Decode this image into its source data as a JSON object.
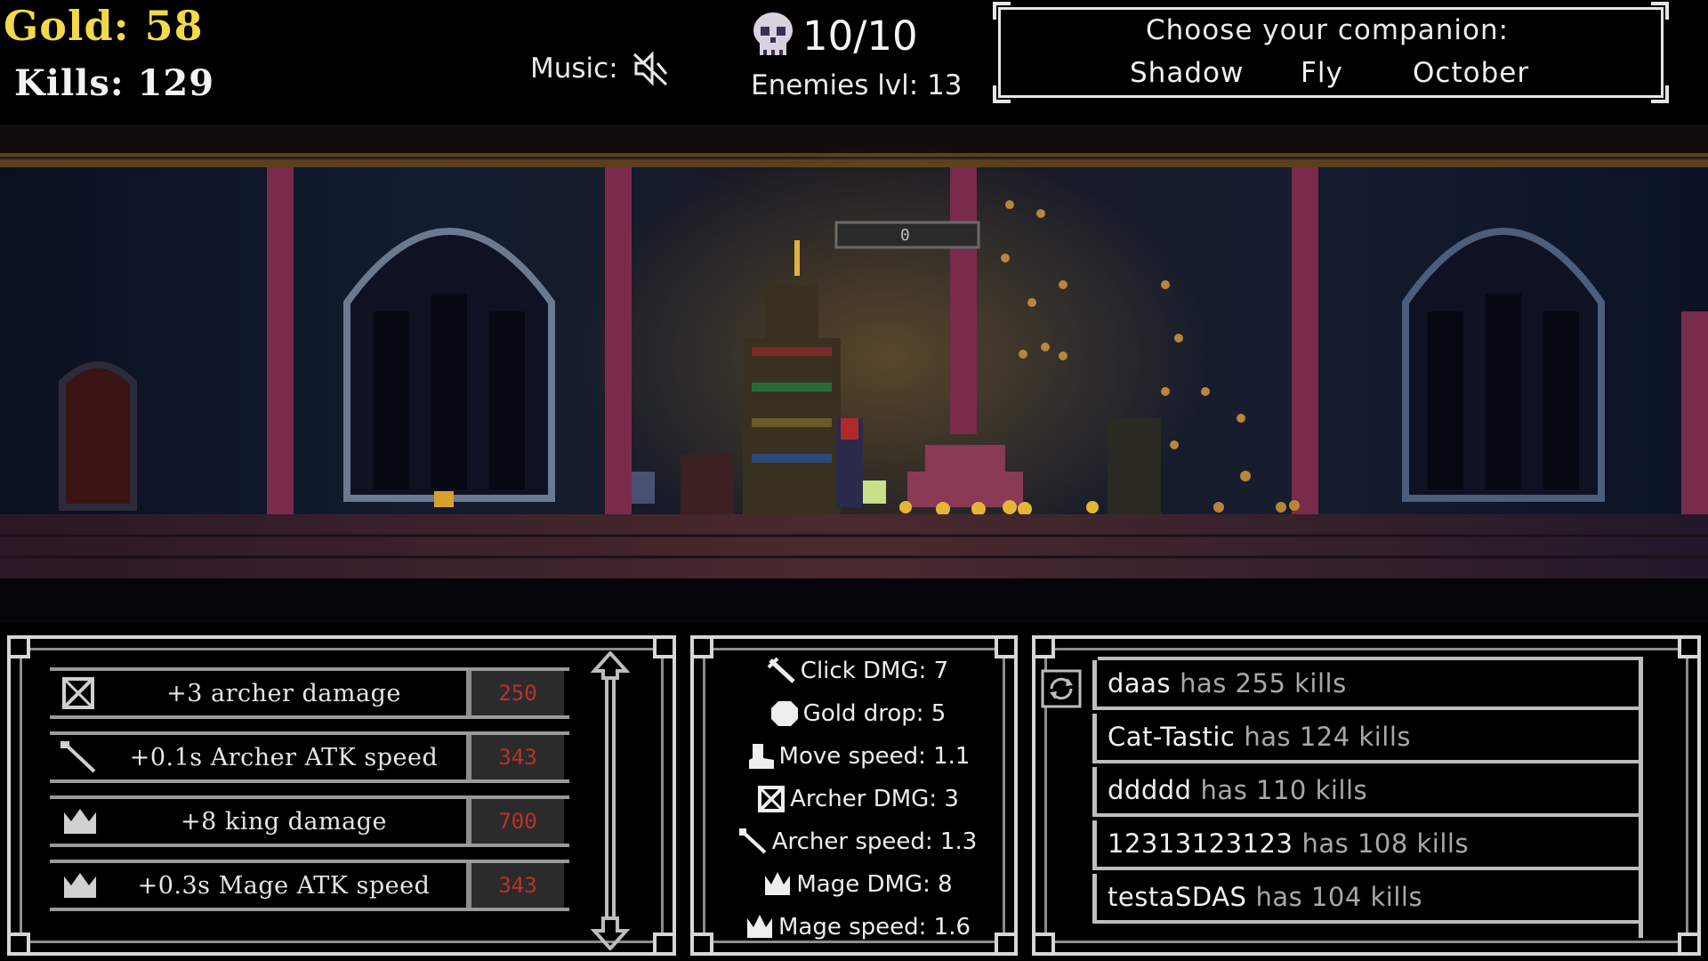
{
  "hud": {
    "gold_text": "Gold: 58",
    "kills_text": "Kills: 129",
    "music_label": "Music:",
    "music_icon": "speaker-muted-icon",
    "enemy_icon": "skull-icon",
    "enemy_count": "10/10",
    "enemy_level": "Enemies lvl: 13"
  },
  "companion": {
    "title": "Choose your companion:",
    "options": [
      "Shadow",
      "Fly",
      "October"
    ]
  },
  "scene": {
    "torch_counter": "0"
  },
  "upgrades": [
    {
      "icon": "crossed-bow-icon",
      "label": "+3 archer damage",
      "cost": "250"
    },
    {
      "icon": "arrow-icon",
      "label": "+0.1s Archer ATK speed",
      "cost": "343"
    },
    {
      "icon": "crown-icon",
      "label": "+8 king damage",
      "cost": "700"
    },
    {
      "icon": "crown-icon",
      "label": "+0.3s Mage ATK speed",
      "cost": "343"
    }
  ],
  "stats": [
    {
      "icon": "sword-icon",
      "text": "Click DMG: 7"
    },
    {
      "icon": "coin-icon",
      "text": "Gold drop: 5"
    },
    {
      "icon": "boot-icon",
      "text": "Move speed: 1.1"
    },
    {
      "icon": "crossed-bow-icon",
      "text": "Archer DMG: 3"
    },
    {
      "icon": "arrow-icon",
      "text": "Archer speed: 1.3"
    },
    {
      "icon": "crown-icon",
      "text": "Mage DMG: 8"
    },
    {
      "icon": "crown-icon",
      "text": "Mage speed: 1.6"
    }
  ],
  "leaderboard": {
    "refresh_icon": "refresh-icon",
    "entries": [
      {
        "name": "daas",
        "suffix": "has 255 kills"
      },
      {
        "name": "Cat-Tastic",
        "suffix": "has 124 kills"
      },
      {
        "name": "ddddd",
        "suffix": "has 110 kills"
      },
      {
        "name": "12313123123",
        "suffix": "has 108 kills"
      },
      {
        "name": "testaSDAS",
        "suffix": "has 104 kills"
      }
    ]
  },
  "colors": {
    "gold": "#f2d94a",
    "cost_red": "#b8322d",
    "frame": "#d7d7d7"
  }
}
